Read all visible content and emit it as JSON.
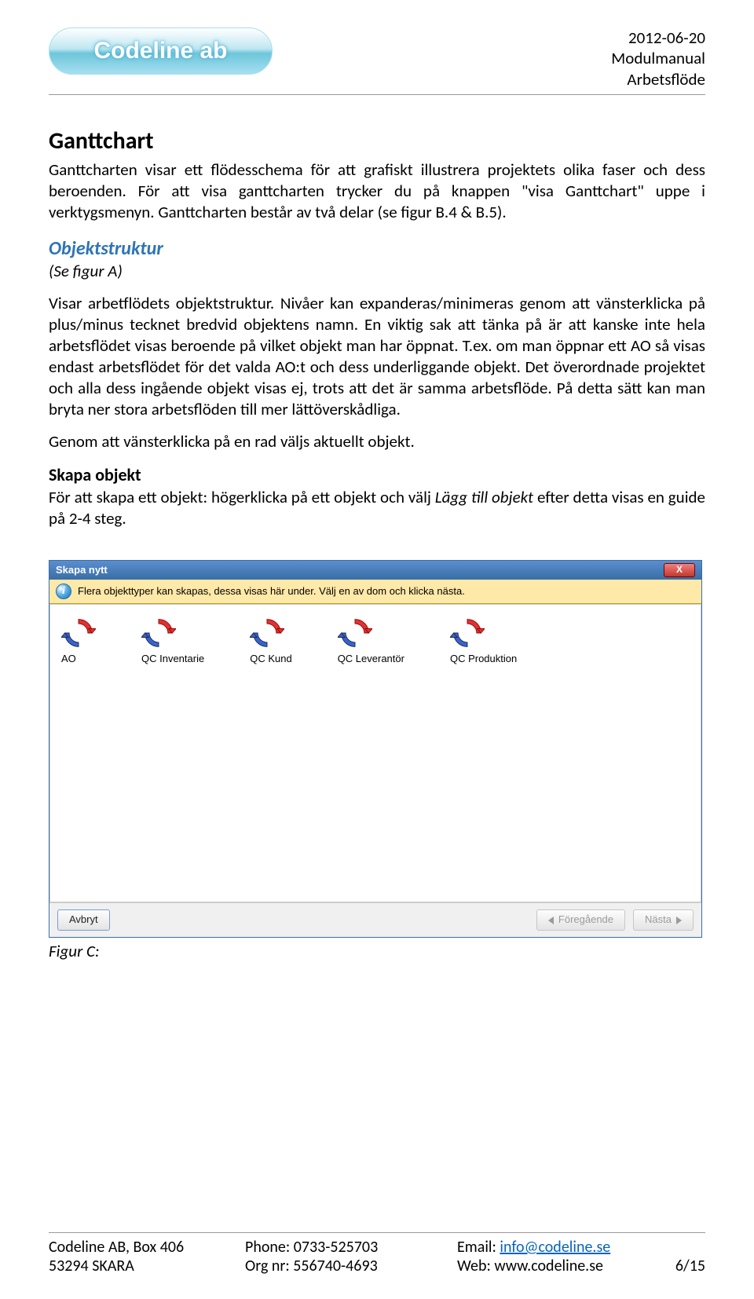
{
  "header": {
    "logo_text": "Codeline ab",
    "date": "2012-06-20",
    "line2": "Modulmanual",
    "line3": "Arbetsflöde"
  },
  "body": {
    "h1": "Ganttchart",
    "intro": "Ganttcharten visar ett flödesschema för att grafiskt illustrera projektets olika faser och dess beroenden. För att visa ganttcharten trycker du på knappen \"visa Ganttchart\" uppe i verktygsmenyn. Ganttcharten består av två delar (se figur B.4 & B.5).",
    "h2a": "Objektstruktur",
    "sub_a": "(Se figur A)",
    "para_a": "Visar arbetflödets objektstruktur. Nivåer kan expanderas/minimeras genom att vänsterklicka på plus/minus tecknet bredvid objektens namn. En viktig sak att tänka på är att kanske inte hela arbetsflödet visas beroende på vilket objekt man har öppnat. T.ex. om man öppnar ett AO så visas endast arbetsflödet för det valda AO:t och dess underliggande objekt. Det överordnade projektet och alla dess ingående objekt visas ej, trots att det är samma arbetsflöde. På detta sätt kan man bryta ner stora arbetsflöden till mer lättöverskådliga.",
    "para_b": "Genom att vänsterklicka på en rad väljs aktuellt objekt.",
    "h3": "Skapa objekt",
    "para_c1": "För att skapa ett objekt: högerklicka på ett objekt och välj ",
    "para_c_em": "Lägg till objekt",
    "para_c2": " efter detta visas en guide på 2-4 steg.",
    "fig_caption": "Figur C:"
  },
  "dialog": {
    "title": "Skapa nytt",
    "info_text": "Flera objekttyper kan skapas, dessa visas här under. Välj en av dom och klicka nästa.",
    "items": [
      {
        "label": "AO"
      },
      {
        "label": "QC Inventarie"
      },
      {
        "label": "QC Kund"
      },
      {
        "label": "QC Leverantör"
      },
      {
        "label": "QC Produktion"
      }
    ],
    "cancel": "Avbryt",
    "prev": "Föregående",
    "next": "Nästa"
  },
  "footer": {
    "company": "Codeline AB, Box 406",
    "city": "53294 SKARA",
    "phone_label": "Phone: 0733-525703",
    "org_label": "Org nr: 556740-4693",
    "email_prefix": "Email: ",
    "email_link": "info@codeline.se",
    "web_prefix": "Web: ",
    "web": "www.codeline.se",
    "page": "6/15"
  }
}
